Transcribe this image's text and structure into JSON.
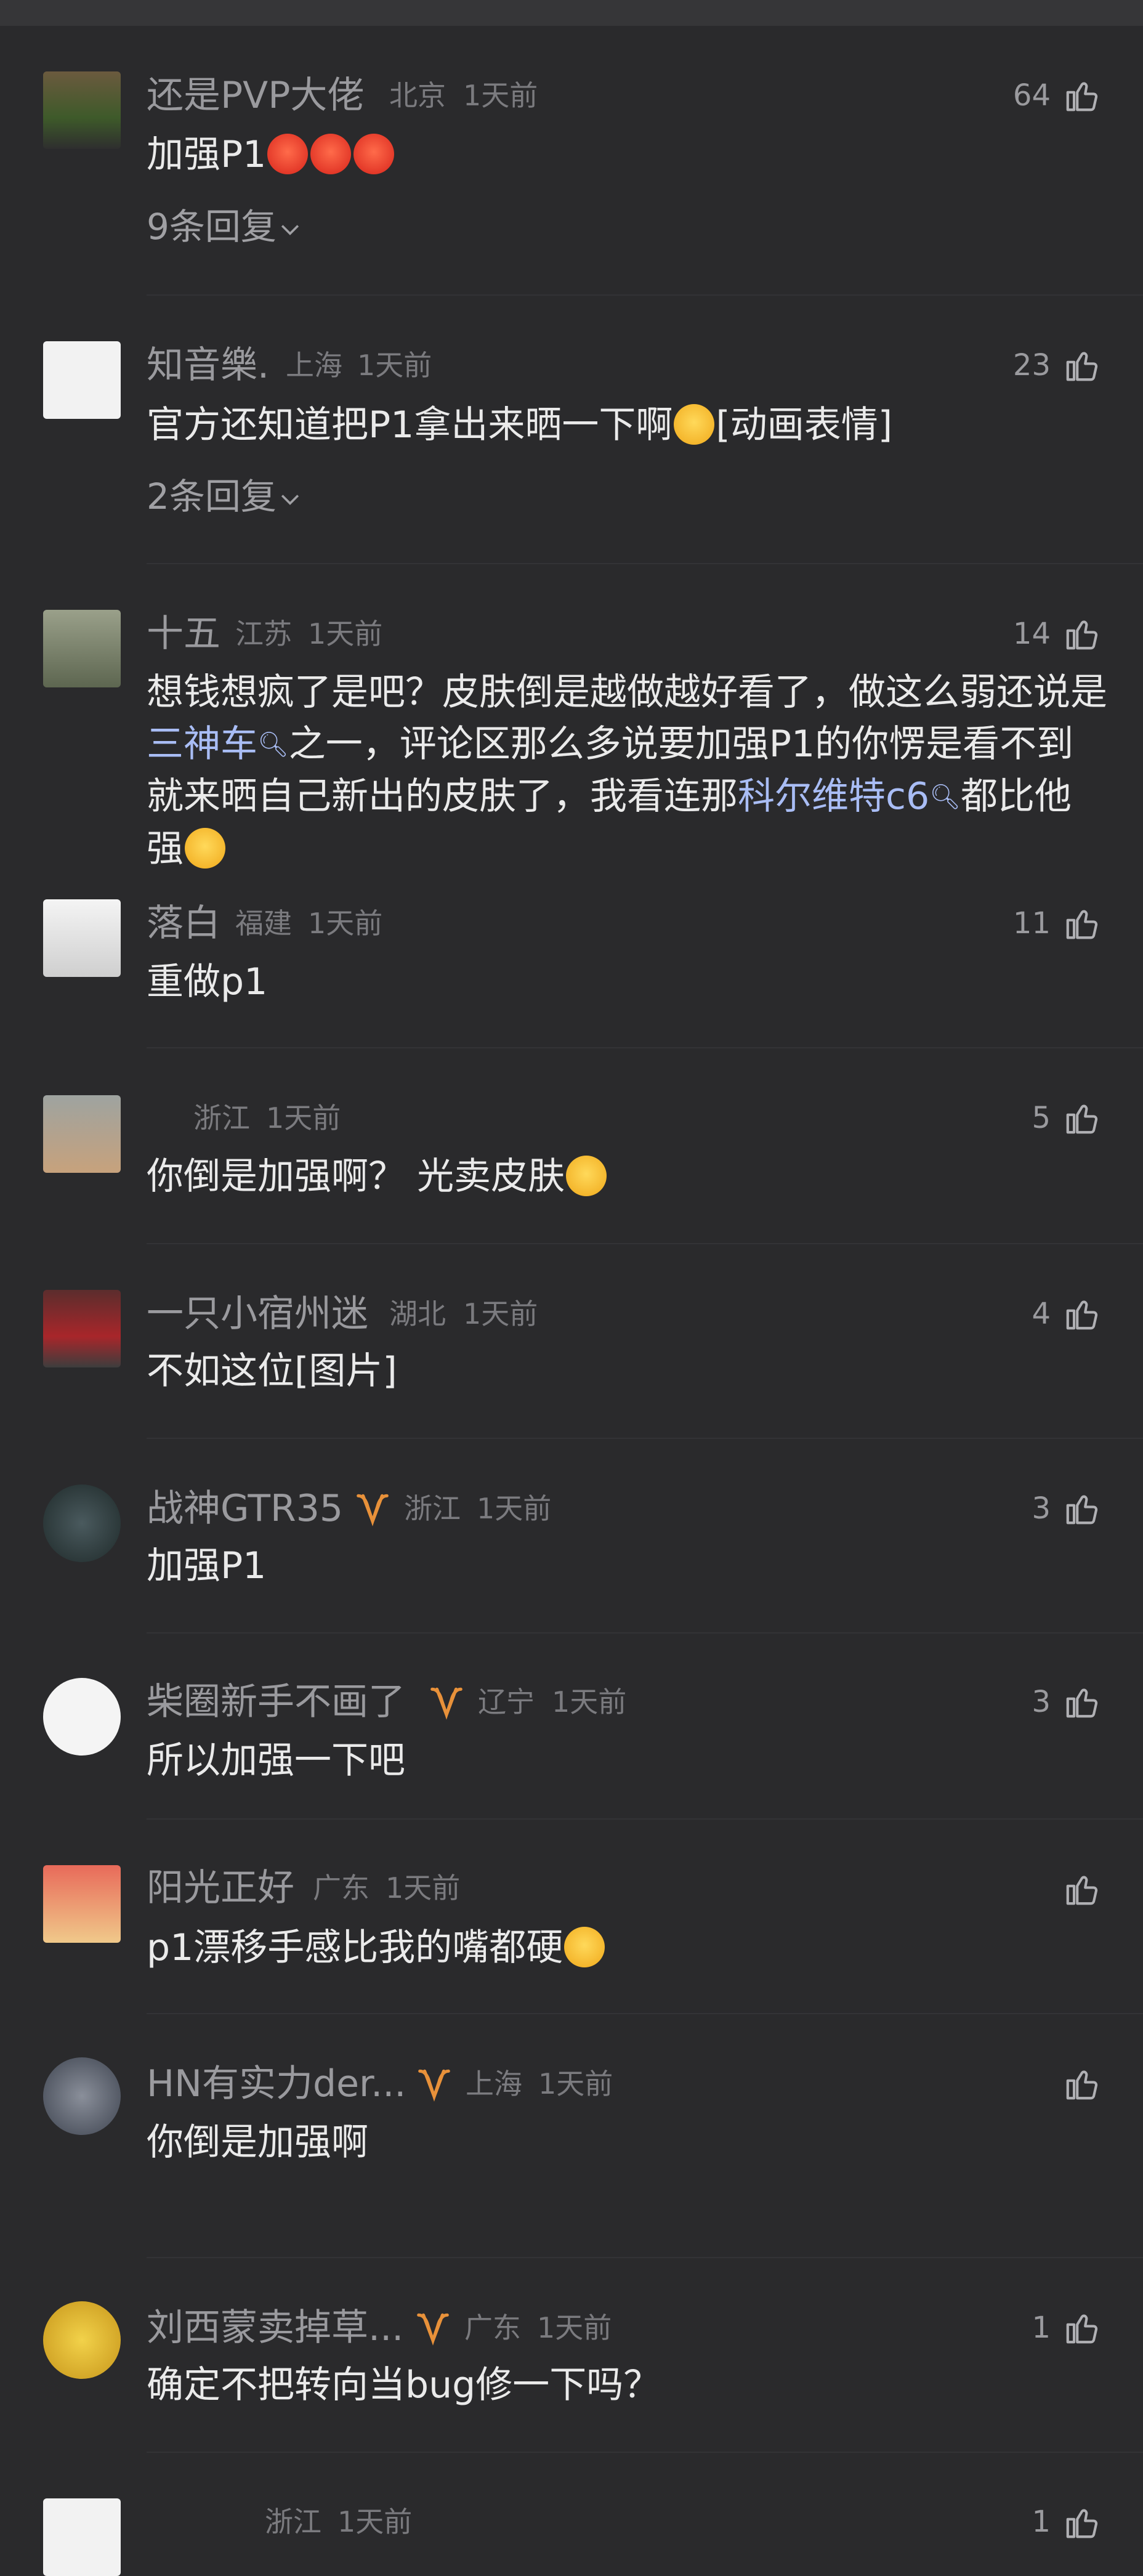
{
  "comments": [
    {
      "username": "还是PVP大佬",
      "location": "北京",
      "time": "1天前",
      "likes": "64",
      "text": "加强P1",
      "replies": "9条回复"
    },
    {
      "username": "知音樂.",
      "location": "上海",
      "time": "1天前",
      "likes": "23",
      "text_before": "官方还知道把P1拿出来晒一下啊",
      "text_after": "[动画表情]",
      "replies": "2条回复"
    },
    {
      "username": "十五",
      "location": "江苏",
      "time": "1天前",
      "likes": "14",
      "text_parts": [
        "想钱想疯了是吧？皮肤倒是越做越好看了，做这么弱还说是",
        "三神车",
        "之一，评论区那么多说要加强P1的你愣是看不到就来晒自己新出的皮肤了，我看连那",
        "科尔维特c6",
        "都比他强"
      ]
    },
    {
      "username": "落白",
      "location": "福建",
      "time": "1天前",
      "likes": "11",
      "text": "重做p1"
    },
    {
      "username": "",
      "location": "浙江",
      "time": "1天前",
      "likes": "5",
      "text": "你倒是加强啊？ 光卖皮肤"
    },
    {
      "username": "一只小宿州迷",
      "location": "湖北",
      "time": "1天前",
      "likes": "4",
      "text": "不如这位[图片]"
    },
    {
      "username": "战神GTR35",
      "location": "浙江",
      "time": "1天前",
      "likes": "3",
      "text": "加强P1"
    },
    {
      "username": "柴圈新手不画了",
      "location": "辽宁",
      "time": "1天前",
      "likes": "3",
      "text": "所以加强一下吧"
    },
    {
      "username": "阳光正好",
      "location": "广东",
      "time": "1天前",
      "likes": "",
      "text": "p1漂移手感比我的嘴都硬"
    },
    {
      "username": "HN有实力der...",
      "location": "上海",
      "time": "1天前",
      "likes": "",
      "text": "你倒是加强啊"
    },
    {
      "username": "刘西蒙卖掉草...",
      "location": "广东",
      "time": "1天前",
      "likes": "1",
      "text": "确定不把转向当bug修一下吗？"
    },
    {
      "username": "",
      "location": "浙江",
      "time": "1天前",
      "likes": "1",
      "text": ""
    }
  ],
  "colors": {
    "background": "#2a2a2c",
    "link": "#a9bdf5",
    "badge": "#e8913a"
  },
  "icons": {
    "like": "thumbs-up-icon",
    "expand": "chevron-down-icon",
    "search": "magnifier-icon",
    "badge": "vip-badge-icon"
  }
}
